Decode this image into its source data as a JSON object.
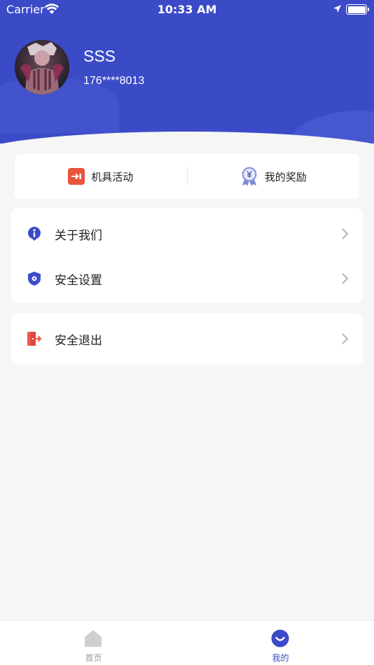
{
  "status_bar": {
    "carrier": "Carrier",
    "time": "10:33 AM"
  },
  "profile": {
    "name": "SSS",
    "phone": "176****8013"
  },
  "quick_actions": [
    {
      "label": "机具活动",
      "icon": "machine-activity-icon"
    },
    {
      "label": "我的奖励",
      "icon": "reward-icon"
    }
  ],
  "menu": {
    "about": {
      "label": "关于我们",
      "icon": "info-icon"
    },
    "security": {
      "label": "安全设置",
      "icon": "shield-icon"
    },
    "logout": {
      "label": "安全退出",
      "icon": "logout-icon"
    }
  },
  "tab_bar": {
    "home": {
      "label": "首页",
      "icon": "home-icon"
    },
    "mine": {
      "label": "我的",
      "icon": "profile-icon"
    }
  },
  "colors": {
    "primary": "#3b4bc8",
    "background": "#f6f6f4",
    "logout_red": "#f0554d",
    "activity_orange": "#e8533c"
  }
}
